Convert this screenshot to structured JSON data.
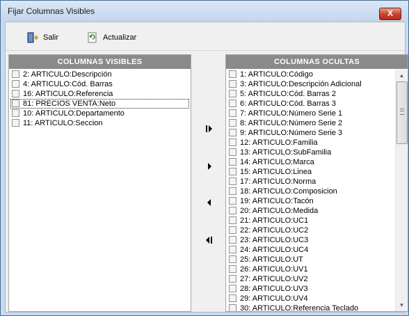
{
  "window": {
    "title": "Fijar Columnas Visibles",
    "close_label": "X"
  },
  "toolbar": {
    "salir_label": "Salir",
    "actualizar_label": "Actualizar"
  },
  "left_panel": {
    "header": "COLUMNAS VISIBLES",
    "items": [
      "2: ARTICULO:Descripción",
      "4: ARTICULO:Cód. Barras",
      "16: ARTICULO:Referencia",
      "81: PRECIOS VENTA:Neto",
      "10: ARTICULO:Departamento",
      "11: ARTICULO:Seccion"
    ]
  },
  "right_panel": {
    "header": "COLUMNAS OCULTAS",
    "items": [
      "1: ARTICULO:Código",
      "3: ARTICULO:Descripción Adicional",
      "5: ARTICULO:Cód. Barras 2",
      "6: ARTICULO:Cód. Barras 3",
      "7: ARTICULO:Número Serie 1",
      "8: ARTICULO:Número Serie 2",
      "9: ARTICULO:Número Serie 3",
      "12: ARTICULO:Familia",
      "13: ARTICULO:SubFamilia",
      "14: ARTICULO:Marca",
      "15: ARTICULO:Linea",
      "17: ARTICULO:Norma",
      "18: ARTICULO:Composicion",
      "19: ARTICULO:Tacón",
      "20: ARTICULO:Medida",
      "21: ARTICULO:UC1",
      "22: ARTICULO:UC2",
      "23: ARTICULO:UC3",
      "24: ARTICULO:UC4",
      "25: ARTICULO:UT",
      "26: ARTICULO:UV1",
      "27: ARTICULO:UV2",
      "28: ARTICULO:UV3",
      "29: ARTICULO:UV4",
      "30: ARTICULO:Referencia Teclado"
    ]
  },
  "colors": {
    "header_bg": "#8a8a8a",
    "title_bar": "#c8daf0",
    "close_red": "#c7402a"
  }
}
